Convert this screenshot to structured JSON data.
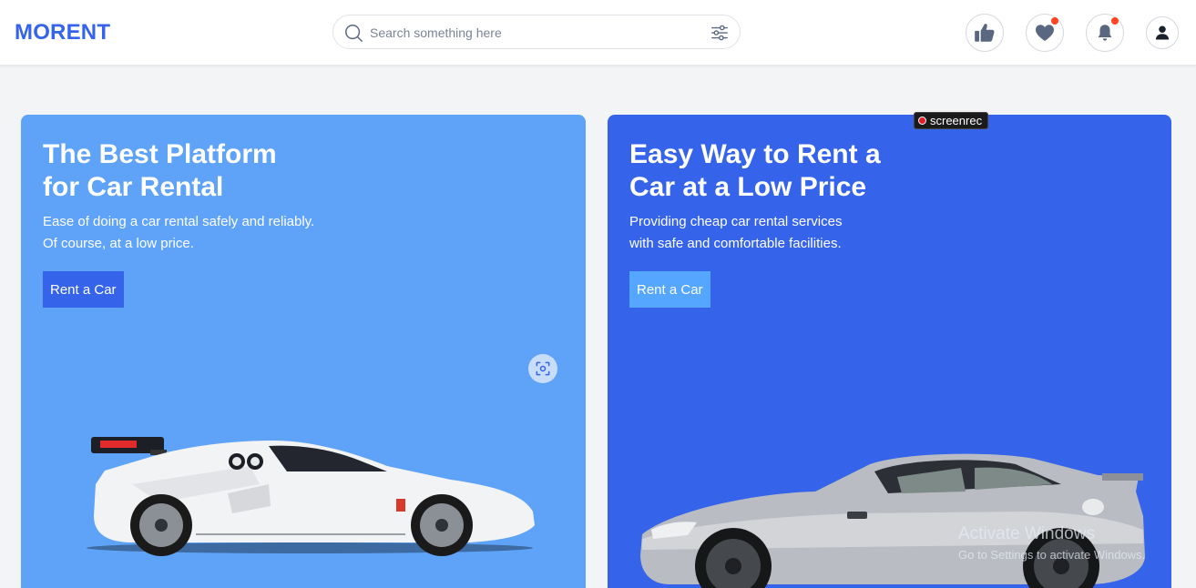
{
  "header": {
    "logo": "MORENT",
    "search_placeholder": "Search something here",
    "icons": [
      "search-icon",
      "filter-icon",
      "like-icon",
      "heart-icon",
      "bell-icon",
      "profile-icon"
    ]
  },
  "cards": [
    {
      "title_line1": "The Best Platform",
      "title_line2": "for Car Rental",
      "desc_line1": "Ease of doing a car rental safely and reliably.",
      "desc_line2": "Of course, at a low price.",
      "button": "Rent a Car",
      "color": "#5ea3f8"
    },
    {
      "title_line1": "Easy Way to Rent a",
      "title_line2": "Car at a Low Price",
      "desc_line1": "Providing cheap car rental services",
      "desc_line2": "with safe and comfortable facilities.",
      "button": "Rent a Car",
      "color": "#3563e9"
    }
  ],
  "overlay": {
    "screenrec": "screenrec",
    "watermark_line1": "Activate Windows",
    "watermark_line2": "Go to Settings to activate Windows."
  },
  "colors": {
    "brand": "#3563e9",
    "notification_dot": "#ff4423"
  }
}
